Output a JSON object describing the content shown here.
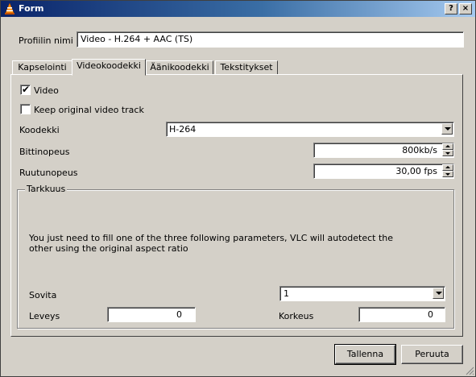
{
  "window": {
    "title": "Form",
    "help_button": "?",
    "close_button": "×"
  },
  "profile": {
    "label": "Profiilin nimi",
    "value": "Video - H.264 + AAC (TS)"
  },
  "tabs": [
    {
      "label": "Kapselointi"
    },
    {
      "label": "Videokoodekki"
    },
    {
      "label": "Äänikoodekki"
    },
    {
      "label": "Tekstitykset"
    }
  ],
  "video_tab": {
    "video_checkbox": {
      "label": "Video",
      "checked": true
    },
    "keep_original": {
      "label": "Keep original video track",
      "checked": false
    },
    "codec": {
      "label": "Koodekki",
      "value": "H-264"
    },
    "bitrate": {
      "label": "Bittinopeus",
      "value": "800kb/s"
    },
    "framerate": {
      "label": "Ruutunopeus",
      "value": "30,00 fps"
    },
    "resolution": {
      "title": "Tarkkuus",
      "hint": "You just need to fill one of the three following parameters, VLC will autodetect the\nother using the original aspect ratio",
      "scale": {
        "label": "Sovita",
        "value": "1"
      },
      "width": {
        "label": "Leveys",
        "value": "0"
      },
      "height": {
        "label": "Korkeus",
        "value": "0"
      }
    }
  },
  "buttons": {
    "save": "Tallenna",
    "cancel": "Peruuta"
  }
}
